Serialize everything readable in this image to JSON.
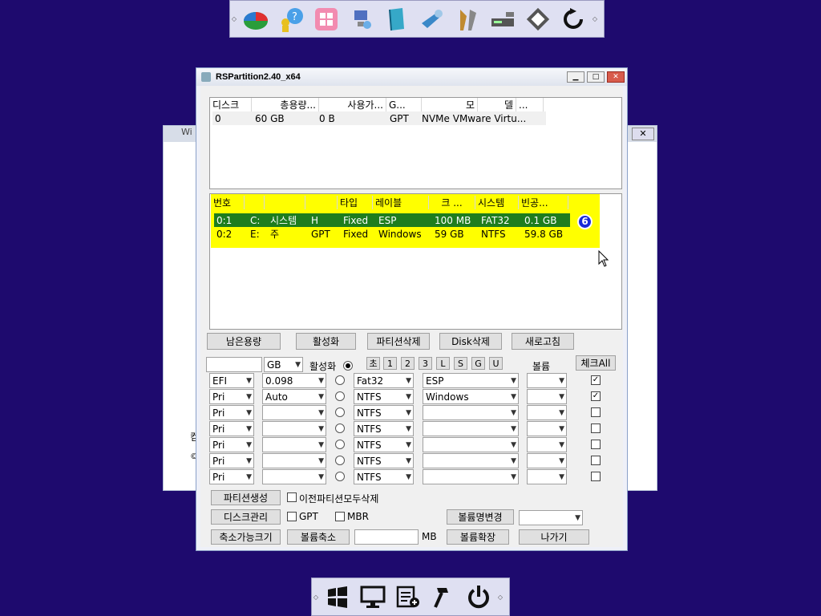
{
  "window": {
    "title": "RSPartition2.40_x64"
  },
  "back_window": {
    "title": "Wi",
    "close": "✕",
    "line1": "컴",
    "line2": "©"
  },
  "disks": {
    "headers": [
      "디스크",
      "총용량...",
      "사용가...",
      "G...",
      "모",
      "델",
      "..."
    ],
    "rows": [
      [
        "0",
        "60 GB",
        "0 B",
        "GPT",
        "NVMe VMware Virtu..."
      ]
    ]
  },
  "partitions": {
    "headers": [
      "번호",
      "",
      "",
      "",
      "타입",
      "레이블",
      "크 ...",
      "시스템",
      "빈공..."
    ],
    "rows": [
      [
        "0:1",
        "C:",
        "시스템",
        "H",
        "Fixed",
        "ESP",
        "100 MB",
        "FAT32",
        "0.1 GB"
      ],
      [
        "0:2",
        "E:",
        "주",
        "GPT",
        "Fixed",
        "Windows",
        "59 GB",
        "NTFS",
        "59.8 GB"
      ]
    ],
    "badge": "6"
  },
  "buttons": {
    "remaining": "남은용량",
    "activate": "활성화",
    "delete_partition": "파티션삭제",
    "delete_disk": "Disk삭제",
    "refresh": "새로고침",
    "create_partition": "파티션생성",
    "disk_mgmt": "디스크관리",
    "rename_volume": "볼륨명변경",
    "shrinkable": "축소가능크기",
    "shrink_volume": "볼륨축소",
    "extend_volume": "볼륨확장",
    "exit": "나가기",
    "check_all": "체크All"
  },
  "controls": {
    "unit": "GB",
    "active_label": "활성화",
    "quick": [
      "초",
      "1",
      "2",
      "3",
      "L",
      "S",
      "G",
      "U"
    ],
    "volume_label": "볼륨",
    "mb": "MB",
    "del_prev": "이전파티션모두삭제",
    "gpt": "GPT",
    "mbr": "MBR"
  },
  "table_rows": [
    {
      "type": "EFI",
      "size": "0.098",
      "fs": "Fat32",
      "label": "ESP",
      "checked": "✓"
    },
    {
      "type": "Pri",
      "size": "Auto",
      "fs": "NTFS",
      "label": "Windows",
      "checked": "✓"
    },
    {
      "type": "Pri",
      "size": "",
      "fs": "NTFS",
      "label": "",
      "checked": ""
    },
    {
      "type": "Pri",
      "size": "",
      "fs": "NTFS",
      "label": "",
      "checked": ""
    },
    {
      "type": "Pri",
      "size": "",
      "fs": "NTFS",
      "label": "",
      "checked": ""
    },
    {
      "type": "Pri",
      "size": "",
      "fs": "NTFS",
      "label": "",
      "checked": ""
    },
    {
      "type": "Pri",
      "size": "",
      "fs": "NTFS",
      "label": "",
      "checked": ""
    }
  ],
  "top_icons": [
    "disk-chart-icon",
    "user-help-icon",
    "windows-store-icon",
    "network-pc-icon",
    "book-icon",
    "pen-key-icon",
    "tools-icon",
    "drive-icon",
    "floppy-icon",
    "refresh-icon"
  ],
  "bottom_icons": [
    "windows-flag-icon",
    "monitor-icon",
    "tasklist-icon",
    "hammer-icon",
    "power-icon"
  ],
  "colors": {
    "desktop": "#1e0a6e",
    "highlight": "#ffff00",
    "selected": "#1e7d1e"
  }
}
